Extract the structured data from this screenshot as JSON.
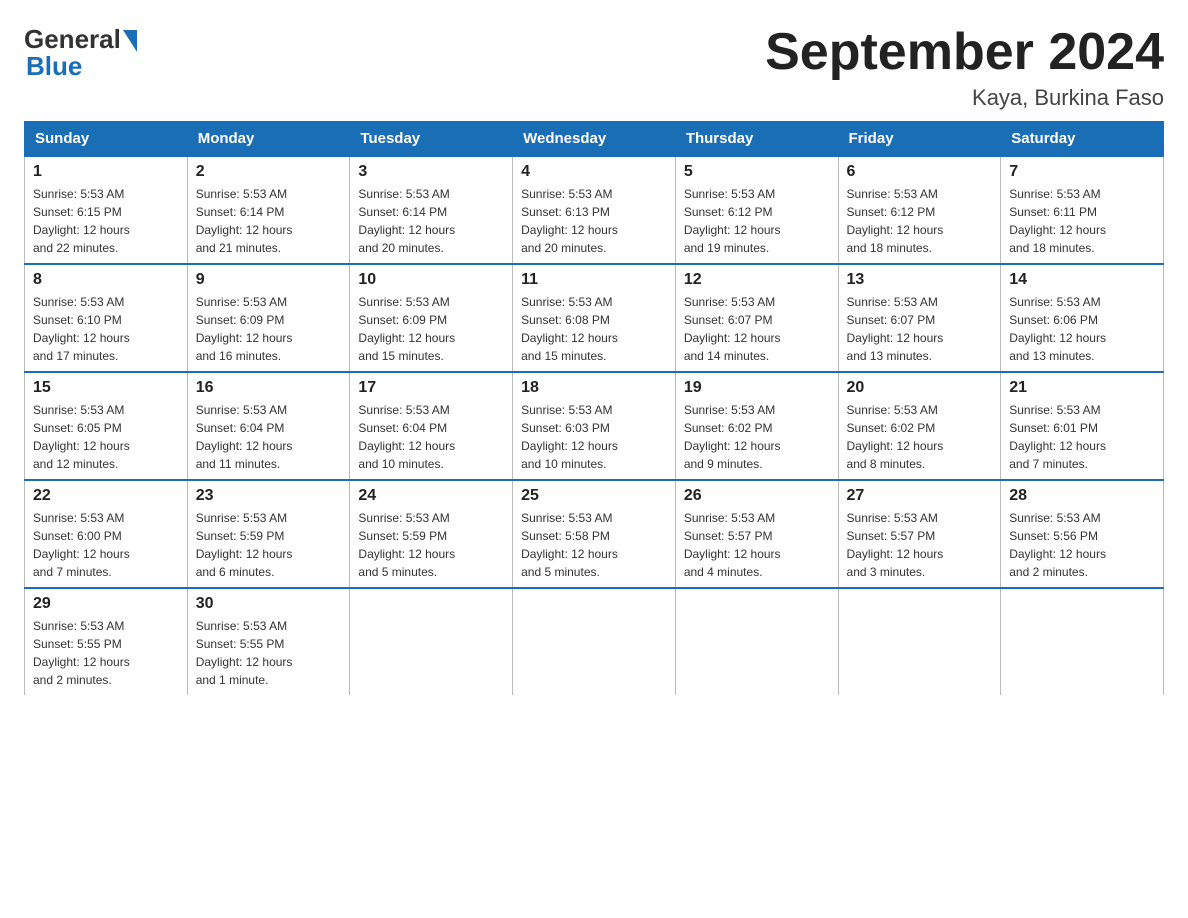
{
  "logo": {
    "general_text": "General",
    "blue_text": "Blue"
  },
  "title": "September 2024",
  "subtitle": "Kaya, Burkina Faso",
  "weekdays": [
    "Sunday",
    "Monday",
    "Tuesday",
    "Wednesday",
    "Thursday",
    "Friday",
    "Saturday"
  ],
  "weeks": [
    [
      {
        "day": "1",
        "sunrise": "5:53 AM",
        "sunset": "6:15 PM",
        "daylight": "12 hours and 22 minutes."
      },
      {
        "day": "2",
        "sunrise": "5:53 AM",
        "sunset": "6:14 PM",
        "daylight": "12 hours and 21 minutes."
      },
      {
        "day": "3",
        "sunrise": "5:53 AM",
        "sunset": "6:14 PM",
        "daylight": "12 hours and 20 minutes."
      },
      {
        "day": "4",
        "sunrise": "5:53 AM",
        "sunset": "6:13 PM",
        "daylight": "12 hours and 20 minutes."
      },
      {
        "day": "5",
        "sunrise": "5:53 AM",
        "sunset": "6:12 PM",
        "daylight": "12 hours and 19 minutes."
      },
      {
        "day": "6",
        "sunrise": "5:53 AM",
        "sunset": "6:12 PM",
        "daylight": "12 hours and 18 minutes."
      },
      {
        "day": "7",
        "sunrise": "5:53 AM",
        "sunset": "6:11 PM",
        "daylight": "12 hours and 18 minutes."
      }
    ],
    [
      {
        "day": "8",
        "sunrise": "5:53 AM",
        "sunset": "6:10 PM",
        "daylight": "12 hours and 17 minutes."
      },
      {
        "day": "9",
        "sunrise": "5:53 AM",
        "sunset": "6:09 PM",
        "daylight": "12 hours and 16 minutes."
      },
      {
        "day": "10",
        "sunrise": "5:53 AM",
        "sunset": "6:09 PM",
        "daylight": "12 hours and 15 minutes."
      },
      {
        "day": "11",
        "sunrise": "5:53 AM",
        "sunset": "6:08 PM",
        "daylight": "12 hours and 15 minutes."
      },
      {
        "day": "12",
        "sunrise": "5:53 AM",
        "sunset": "6:07 PM",
        "daylight": "12 hours and 14 minutes."
      },
      {
        "day": "13",
        "sunrise": "5:53 AM",
        "sunset": "6:07 PM",
        "daylight": "12 hours and 13 minutes."
      },
      {
        "day": "14",
        "sunrise": "5:53 AM",
        "sunset": "6:06 PM",
        "daylight": "12 hours and 13 minutes."
      }
    ],
    [
      {
        "day": "15",
        "sunrise": "5:53 AM",
        "sunset": "6:05 PM",
        "daylight": "12 hours and 12 minutes."
      },
      {
        "day": "16",
        "sunrise": "5:53 AM",
        "sunset": "6:04 PM",
        "daylight": "12 hours and 11 minutes."
      },
      {
        "day": "17",
        "sunrise": "5:53 AM",
        "sunset": "6:04 PM",
        "daylight": "12 hours and 10 minutes."
      },
      {
        "day": "18",
        "sunrise": "5:53 AM",
        "sunset": "6:03 PM",
        "daylight": "12 hours and 10 minutes."
      },
      {
        "day": "19",
        "sunrise": "5:53 AM",
        "sunset": "6:02 PM",
        "daylight": "12 hours and 9 minutes."
      },
      {
        "day": "20",
        "sunrise": "5:53 AM",
        "sunset": "6:02 PM",
        "daylight": "12 hours and 8 minutes."
      },
      {
        "day": "21",
        "sunrise": "5:53 AM",
        "sunset": "6:01 PM",
        "daylight": "12 hours and 7 minutes."
      }
    ],
    [
      {
        "day": "22",
        "sunrise": "5:53 AM",
        "sunset": "6:00 PM",
        "daylight": "12 hours and 7 minutes."
      },
      {
        "day": "23",
        "sunrise": "5:53 AM",
        "sunset": "5:59 PM",
        "daylight": "12 hours and 6 minutes."
      },
      {
        "day": "24",
        "sunrise": "5:53 AM",
        "sunset": "5:59 PM",
        "daylight": "12 hours and 5 minutes."
      },
      {
        "day": "25",
        "sunrise": "5:53 AM",
        "sunset": "5:58 PM",
        "daylight": "12 hours and 5 minutes."
      },
      {
        "day": "26",
        "sunrise": "5:53 AM",
        "sunset": "5:57 PM",
        "daylight": "12 hours and 4 minutes."
      },
      {
        "day": "27",
        "sunrise": "5:53 AM",
        "sunset": "5:57 PM",
        "daylight": "12 hours and 3 minutes."
      },
      {
        "day": "28",
        "sunrise": "5:53 AM",
        "sunset": "5:56 PM",
        "daylight": "12 hours and 2 minutes."
      }
    ],
    [
      {
        "day": "29",
        "sunrise": "5:53 AM",
        "sunset": "5:55 PM",
        "daylight": "12 hours and 2 minutes."
      },
      {
        "day": "30",
        "sunrise": "5:53 AM",
        "sunset": "5:55 PM",
        "daylight": "12 hours and 1 minute."
      },
      null,
      null,
      null,
      null,
      null
    ]
  ],
  "labels": {
    "sunrise": "Sunrise:",
    "sunset": "Sunset:",
    "daylight": "Daylight:"
  }
}
